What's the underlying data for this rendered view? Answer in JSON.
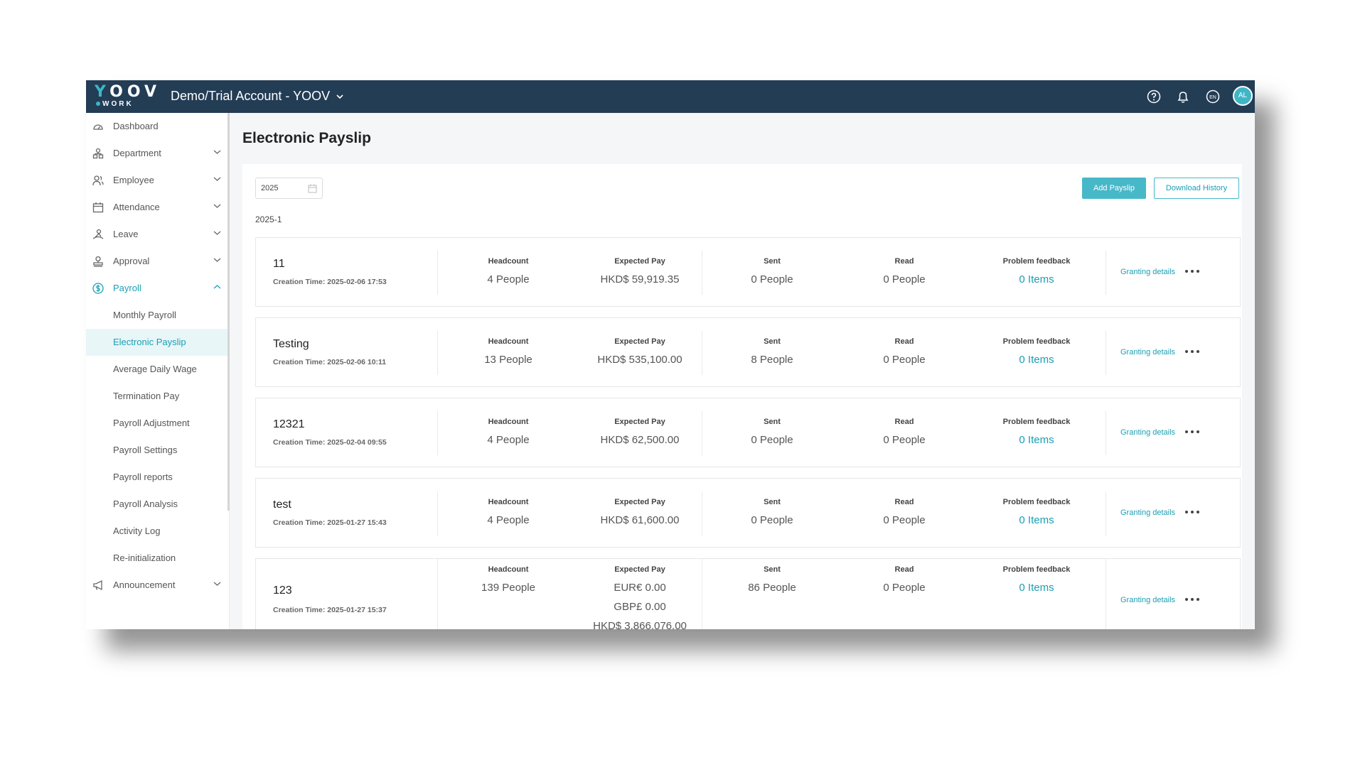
{
  "header": {
    "logo_top": "YOOV",
    "logo_bottom": "WORK",
    "account": "Demo/Trial Account - YOOV",
    "avatar": "AL",
    "language_badge": "EN",
    "brand_color": "#233d55",
    "accent_color": "#47b8c8"
  },
  "sidebar": {
    "items": [
      {
        "label": "Dashboard",
        "icon": "dashboard-icon"
      },
      {
        "label": "Department",
        "icon": "department-icon"
      },
      {
        "label": "Employee",
        "icon": "employee-icon"
      },
      {
        "label": "Attendance",
        "icon": "calendar-icon"
      },
      {
        "label": "Leave",
        "icon": "leave-icon"
      },
      {
        "label": "Approval",
        "icon": "approval-icon"
      },
      {
        "label": "Payroll",
        "icon": "dollar-icon"
      },
      {
        "label": "Announcement",
        "icon": "megaphone-icon"
      }
    ],
    "payroll_sub": [
      "Monthly Payroll",
      "Electronic Payslip",
      "Average Daily Wage",
      "Termination Pay",
      "Payroll Adjustment",
      "Payroll Settings",
      "Payroll reports",
      "Payroll Analysis",
      "Activity Log",
      "Re-initialization"
    ],
    "active_sub": "Electronic Payslip"
  },
  "main": {
    "title": "Electronic Payslip",
    "year": "2025",
    "add_button": "Add Payslip",
    "history_button": "Download History",
    "group_label": "2025-1",
    "col_headcount": "Headcount",
    "col_expected": "Expected Pay",
    "col_sent": "Sent",
    "col_read": "Read",
    "col_feedback": "Problem feedback",
    "granting": "Granting details",
    "payslips": [
      {
        "name": "11",
        "created": "Creation Time: 2025-02-06 17:53",
        "headcount": "4 People",
        "expected": [
          "HKD$ 59,919.35"
        ],
        "sent": "0 People",
        "read": "0 People",
        "feedback": "0 Items"
      },
      {
        "name": "Testing",
        "created": "Creation Time: 2025-02-06 10:11",
        "headcount": "13 People",
        "expected": [
          "HKD$ 535,100.00"
        ],
        "sent": "8 People",
        "read": "0 People",
        "feedback": "0 Items"
      },
      {
        "name": "12321",
        "created": "Creation Time: 2025-02-04 09:55",
        "headcount": "4 People",
        "expected": [
          "HKD$ 62,500.00"
        ],
        "sent": "0 People",
        "read": "0 People",
        "feedback": "0 Items"
      },
      {
        "name": "test",
        "created": "Creation Time: 2025-01-27 15:43",
        "headcount": "4 People",
        "expected": [
          "HKD$ 61,600.00"
        ],
        "sent": "0 People",
        "read": "0 People",
        "feedback": "0 Items"
      },
      {
        "name": "123",
        "created": "Creation Time: 2025-01-27 15:37",
        "headcount": "139 People",
        "expected": [
          "EUR€ 0.00",
          "GBP£ 0.00",
          "HKD$ 3,866,076.00"
        ],
        "sent": "86 People",
        "read": "0 People",
        "feedback": "0 Items"
      }
    ]
  }
}
